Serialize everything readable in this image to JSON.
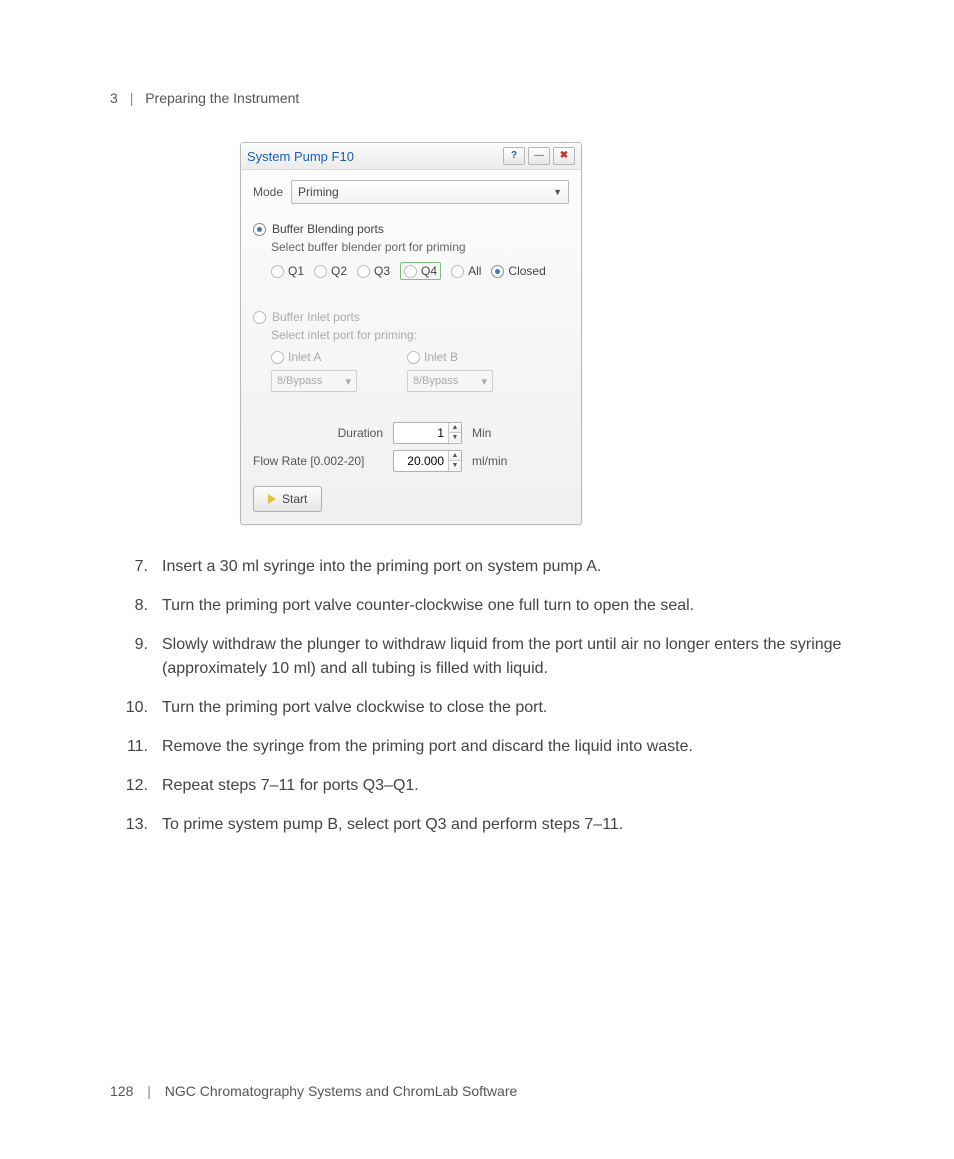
{
  "header": {
    "chapter_no": "3",
    "chapter_title": "Preparing the Instrument"
  },
  "dialog": {
    "title": "System Pump F10",
    "mode_label": "Mode",
    "mode_value": "Priming",
    "blending": {
      "title": "Buffer Blending ports",
      "sub": "Select buffer blender port for priming",
      "opts": [
        "Q1",
        "Q2",
        "Q3",
        "Q4",
        "All",
        "Closed"
      ],
      "selected": "Closed",
      "boxed": "Q4"
    },
    "inlet": {
      "title": "Buffer Inlet ports",
      "sub": "Select inlet port for priming:",
      "a_label": "Inlet A",
      "b_label": "Inlet B",
      "a_value": "8/Bypass",
      "b_value": "8/Bypass"
    },
    "duration_label": "Duration",
    "duration_value": "1",
    "duration_unit": "Min",
    "flow_label": "Flow Rate [0.002-20]",
    "flow_value": "20.000",
    "flow_unit": "ml/min",
    "start_label": "Start"
  },
  "steps": [
    {
      "n": "7.",
      "t": "Insert a 30 ml syringe into the priming port on system pump A."
    },
    {
      "n": "8.",
      "t": "Turn the priming port valve counter-clockwise one full turn to open the seal."
    },
    {
      "n": "9.",
      "t": "Slowly withdraw the plunger to withdraw liquid from the port until air no longer enters the syringe (approximately 10 ml) and all tubing is filled with liquid."
    },
    {
      "n": "10.",
      "t": "Turn the priming port valve clockwise to close the port."
    },
    {
      "n": "11.",
      "t": "Remove the syringe from the priming port and discard the liquid into waste."
    },
    {
      "n": "12.",
      "t": "Repeat steps 7–11 for ports Q3–Q1."
    },
    {
      "n": "13.",
      "t": "To prime system pump B, select port Q3 and perform steps 7–11."
    }
  ],
  "footer": {
    "page_no": "128",
    "book": "NGC Chromatography Systems and ChromLab Software"
  }
}
